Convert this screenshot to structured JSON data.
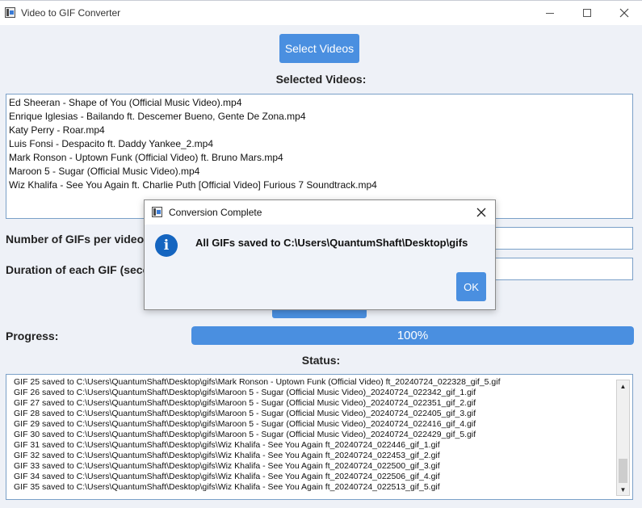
{
  "window": {
    "title": "Video to GIF Converter"
  },
  "main": {
    "select_button": "Select Videos",
    "selected_title": "Selected Videos:",
    "videos": [
      "Ed Sheeran - Shape of You (Official Music Video).mp4",
      "Enrique Iglesias - Bailando ft. Descemer Bueno, Gente De Zona.mp4",
      "Katy Perry - Roar.mp4",
      "Luis Fonsi - Despacito ft. Daddy Yankee_2.mp4",
      "Mark Ronson - Uptown Funk (Official Video) ft. Bruno Mars.mp4",
      "Maroon 5 - Sugar (Official Music Video).mp4",
      "Wiz Khalifa - See You Again ft. Charlie Puth [Official Video] Furious 7 Soundtrack.mp4"
    ],
    "gifs_per_video_label": "Number of GIFs per video:",
    "duration_label": "Duration of each GIF (seconds):",
    "progress_label": "Progress:",
    "progress_value": 1.0,
    "progress_text": "100%",
    "status_title": "Status:",
    "status_lines": [
      "GIF 25 saved to C:\\Users\\QuantumShaft\\Desktop\\gifs\\Mark Ronson - Uptown Funk (Official Video) ft_20240724_022328_gif_5.gif",
      "GIF 26 saved to C:\\Users\\QuantumShaft\\Desktop\\gifs\\Maroon 5 - Sugar (Official Music Video)_20240724_022342_gif_1.gif",
      "GIF 27 saved to C:\\Users\\QuantumShaft\\Desktop\\gifs\\Maroon 5 - Sugar (Official Music Video)_20240724_022351_gif_2.gif",
      "GIF 28 saved to C:\\Users\\QuantumShaft\\Desktop\\gifs\\Maroon 5 - Sugar (Official Music Video)_20240724_022405_gif_3.gif",
      "GIF 29 saved to C:\\Users\\QuantumShaft\\Desktop\\gifs\\Maroon 5 - Sugar (Official Music Video)_20240724_022416_gif_4.gif",
      "GIF 30 saved to C:\\Users\\QuantumShaft\\Desktop\\gifs\\Maroon 5 - Sugar (Official Music Video)_20240724_022429_gif_5.gif",
      "GIF 31 saved to C:\\Users\\QuantumShaft\\Desktop\\gifs\\Wiz Khalifa - See You Again ft_20240724_022446_gif_1.gif",
      "GIF 32 saved to C:\\Users\\QuantumShaft\\Desktop\\gifs\\Wiz Khalifa - See You Again ft_20240724_022453_gif_2.gif",
      "GIF 33 saved to C:\\Users\\QuantumShaft\\Desktop\\gifs\\Wiz Khalifa - See You Again ft_20240724_022500_gif_3.gif",
      "GIF 34 saved to C:\\Users\\QuantumShaft\\Desktop\\gifs\\Wiz Khalifa - See You Again ft_20240724_022506_gif_4.gif",
      "GIF 35 saved to C:\\Users\\QuantumShaft\\Desktop\\gifs\\Wiz Khalifa - See You Again ft_20240724_022513_gif_5.gif"
    ]
  },
  "dialog": {
    "title": "Conversion Complete",
    "message": "All GIFs saved to C:\\Users\\QuantumShaft\\Desktop\\gifs",
    "ok_label": "OK",
    "icon": "info-icon"
  },
  "colors": {
    "accent": "#4a8fe0",
    "background": "#eef1f7",
    "info_icon": "#1565c0"
  }
}
